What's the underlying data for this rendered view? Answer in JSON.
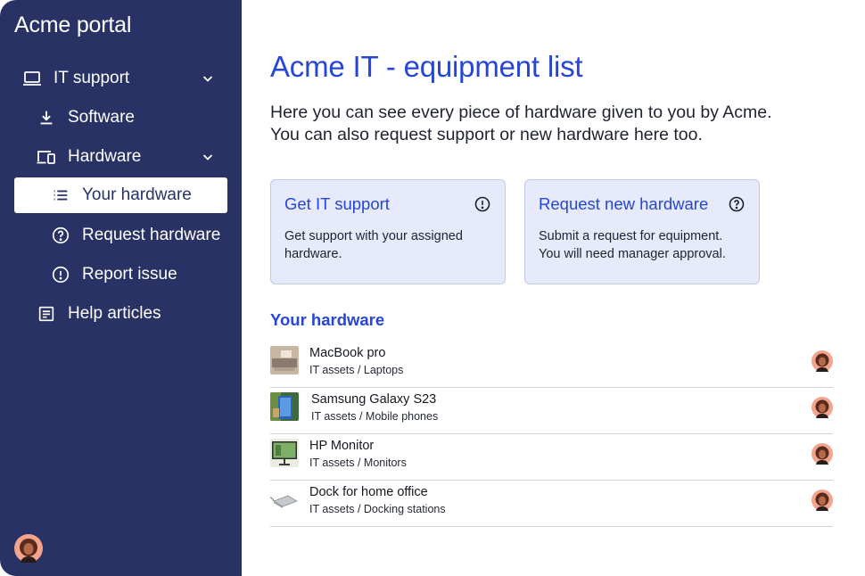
{
  "app": {
    "title": "Acme portal"
  },
  "sidebar": {
    "items": [
      {
        "label": "IT support",
        "icon": "laptop-icon",
        "expanded": true
      },
      {
        "label": "Software",
        "icon": "download-icon"
      },
      {
        "label": "Hardware",
        "icon": "devices-icon",
        "expanded": true
      },
      {
        "label": "Your hardware",
        "icon": "list-icon",
        "active": true
      },
      {
        "label": "Request hardware",
        "icon": "question-circle-icon"
      },
      {
        "label": "Report issue",
        "icon": "alert-circle-icon"
      },
      {
        "label": "Help articles",
        "icon": "article-icon"
      }
    ]
  },
  "main": {
    "title": "Acme IT - equipment list",
    "intro_line1": "Here you can see every piece of hardware given to you by Acme.",
    "intro_line2": "You can also request support or new hardware here too.",
    "cards": [
      {
        "title": "Get IT support",
        "icon": "alert-circle-icon",
        "desc": "Get support with your  assigned hardware."
      },
      {
        "title": "Request new hardware",
        "icon": "question-circle-icon",
        "desc": "Submit a request for equipment. You will need manager approval."
      }
    ],
    "section_title": "Your hardware",
    "hardware": [
      {
        "name": "MacBook pro",
        "category": "IT assets  /  Laptops"
      },
      {
        "name": "Samsung Galaxy S23",
        "category": "IT assets / Mobile phones"
      },
      {
        "name": "HP Monitor",
        "category": "IT assets / Monitors"
      },
      {
        "name": "Dock for home office",
        "category": "IT assets / Docking stations"
      }
    ]
  },
  "colors": {
    "sidebar_bg": "#283264",
    "accent": "#2546d6",
    "card_bg": "#e7eafa"
  }
}
